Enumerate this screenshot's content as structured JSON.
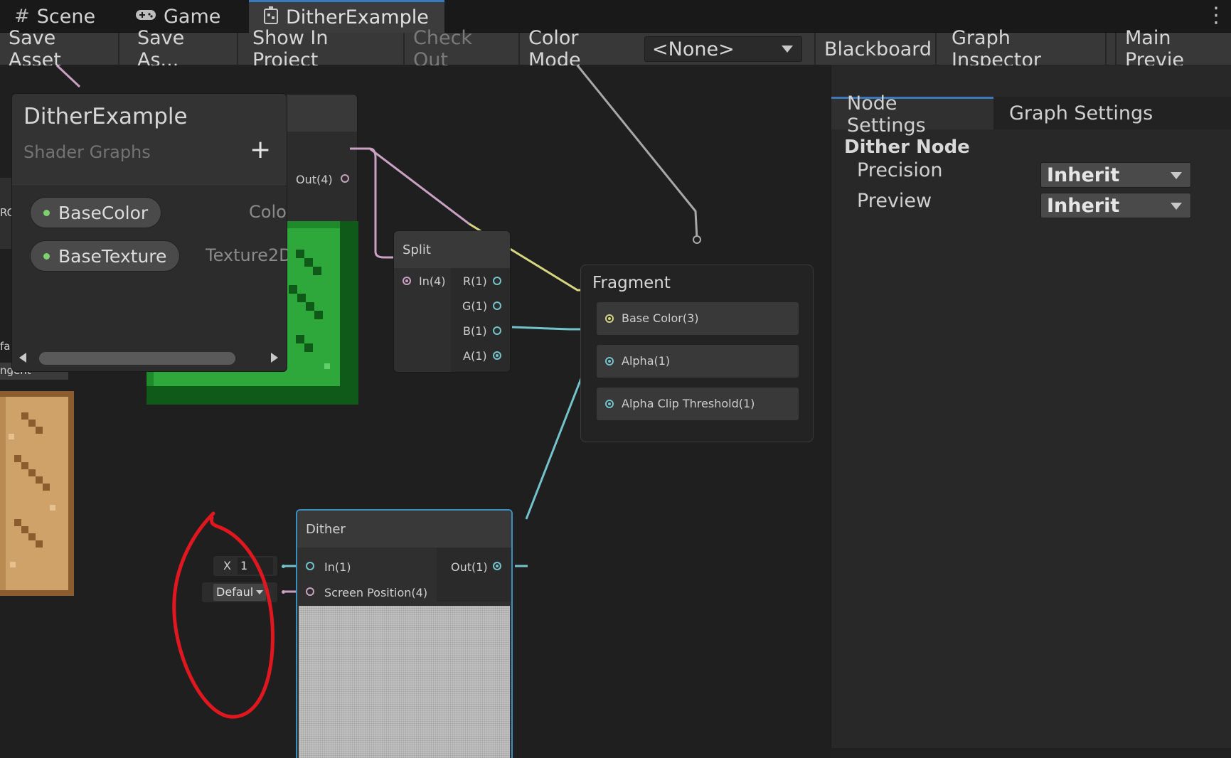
{
  "tabs": [
    {
      "label": "Scene",
      "icon": "grid-icon",
      "active": false
    },
    {
      "label": "Game",
      "icon": "gamepad-icon",
      "active": false
    },
    {
      "label": "DitherExample",
      "icon": "shader-graph-icon",
      "active": true
    }
  ],
  "toolbar": {
    "save_asset": "Save Asset",
    "save_as": "Save As...",
    "show_in_project": "Show In Project",
    "check_out": "Check Out",
    "color_mode_label": "Color Mode",
    "color_mode_value": "<None>",
    "blackboard": "Blackboard",
    "graph_inspector": "Graph Inspector",
    "main_preview": "Main Previe"
  },
  "blackboard": {
    "title": "DitherExample",
    "subtitle": "Shader Graphs",
    "add": "+",
    "properties": [
      {
        "name": "BaseColor",
        "type": "Colo"
      },
      {
        "name": "BaseTexture",
        "type": "Texture2D"
      }
    ]
  },
  "nodes": {
    "texture": {
      "out_label": "Out(4)"
    },
    "split": {
      "title": "Split",
      "in_label": "In(4)",
      "outputs": [
        "R(1)",
        "G(1)",
        "B(1)",
        "A(1)"
      ]
    },
    "fragment": {
      "title": "Fragment",
      "inputs": [
        "Base Color(3)",
        "Alpha(1)",
        "Alpha Clip Threshold(1)"
      ]
    },
    "dither": {
      "title": "Dither",
      "in_label": "In(1)",
      "screen_pos_label": "Screen Position(4)",
      "out_label": "Out(1)"
    },
    "inline_x": {
      "axis": "X",
      "value": "1"
    },
    "inline_default": {
      "value": "Defaul"
    }
  },
  "left_edge": {
    "t1": "RC",
    "t2": "fa",
    "t3": "ngent"
  },
  "inspector": {
    "tabs": [
      "Node Settings",
      "Graph Settings"
    ],
    "section_title": "Dither Node",
    "fields": [
      {
        "label": "Precision",
        "value": "Inherit"
      },
      {
        "label": "Preview",
        "value": "Inherit"
      }
    ]
  },
  "colors": {
    "accent": "#3a79bb",
    "wire_pink": "#c9a1c3",
    "wire_teal": "#74c3cc",
    "wire_yellow": "#d7d57f",
    "annotation_red": "#e0171f"
  }
}
